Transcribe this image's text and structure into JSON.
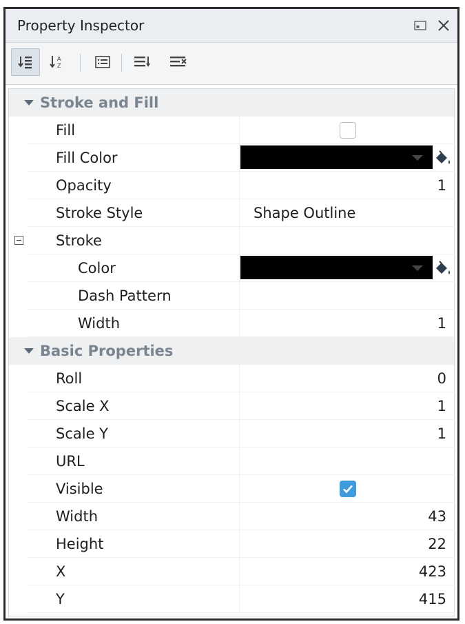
{
  "window": {
    "title": "Property Inspector",
    "icons": {
      "restore": "window-restore-icon",
      "close": "close-icon"
    }
  },
  "toolbar": {
    "buttons": [
      {
        "name": "categorized-view",
        "icon": "sort-categorized-icon",
        "active": true
      },
      {
        "name": "alphabetical-sort",
        "icon": "sort-alphabetical-icon",
        "active": false
      },
      {
        "name": "property-pages",
        "icon": "property-pages-icon",
        "active": false
      },
      {
        "name": "expand-all",
        "icon": "expand-all-icon",
        "active": false
      },
      {
        "name": "collapse-all",
        "icon": "collapse-all-icon",
        "active": false
      }
    ]
  },
  "categories": {
    "stroke_fill": {
      "label": "Stroke and Fill",
      "props": {
        "fill": {
          "name": "Fill",
          "checked": false
        },
        "fill_color": {
          "name": "Fill Color",
          "color": "#000000"
        },
        "opacity": {
          "name": "Opacity",
          "value": "1"
        },
        "stroke_style": {
          "name": "Stroke Style",
          "value": "Shape Outline"
        },
        "stroke": {
          "name": "Stroke"
        },
        "stroke_color": {
          "name": "Color",
          "color": "#000000"
        },
        "dash_pattern": {
          "name": "Dash Pattern",
          "value": ""
        },
        "stroke_width": {
          "name": "Width",
          "value": "1"
        }
      }
    },
    "basic": {
      "label": "Basic Properties",
      "props": {
        "roll": {
          "name": "Roll",
          "value": "0"
        },
        "scale_x": {
          "name": "Scale X",
          "value": "1"
        },
        "scale_y": {
          "name": "Scale Y",
          "value": "1"
        },
        "url": {
          "name": "URL",
          "value": ""
        },
        "visible": {
          "name": "Visible",
          "checked": true
        },
        "width": {
          "name": "Width",
          "value": "43"
        },
        "height": {
          "name": "Height",
          "value": "22"
        },
        "x": {
          "name": "X",
          "value": "423"
        },
        "y": {
          "name": "Y",
          "value": "415"
        }
      }
    }
  },
  "colors": {
    "accent_check": "#3d9bde",
    "category_bg": "#eef0f2",
    "category_text": "#7b8591",
    "titlebar_bg": "#eaedf1"
  }
}
